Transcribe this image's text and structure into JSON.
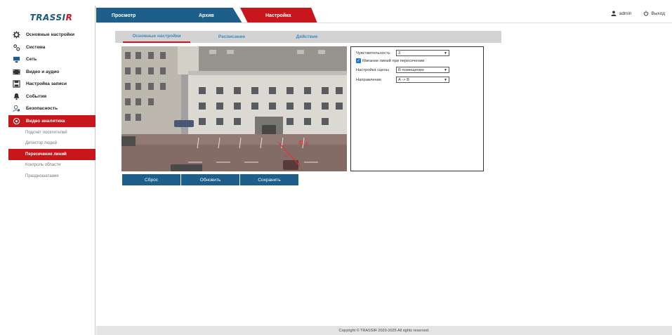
{
  "brand": {
    "logo_main": "TRASSI",
    "logo_r": "R"
  },
  "sidebar": {
    "items": [
      {
        "label": "Основные настройки",
        "icon": "gear-icon"
      },
      {
        "label": "Система",
        "icon": "gears-icon"
      },
      {
        "label": "Сеть",
        "icon": "network-icon"
      },
      {
        "label": "Видео и аудио",
        "icon": "video-icon"
      },
      {
        "label": "Настройка записи",
        "icon": "save-icon"
      },
      {
        "label": "События",
        "icon": "bell-icon"
      },
      {
        "label": "Безопасность",
        "icon": "user-lock-icon"
      },
      {
        "label": "Видео аналитика",
        "icon": "analytics-icon"
      }
    ],
    "subitems": [
      {
        "label": "Подсчёт посетителей"
      },
      {
        "label": "Детектор людей"
      },
      {
        "label": "Пересечение линий"
      },
      {
        "label": "Контроль области"
      },
      {
        "label": "Праздношатание"
      }
    ]
  },
  "topnav": {
    "tabs": [
      {
        "label": "Просмотр"
      },
      {
        "label": "Архив"
      },
      {
        "label": "Настройка"
      }
    ],
    "user": "admin",
    "logout": "Выход"
  },
  "subtabs": [
    {
      "label": "Основные настройки"
    },
    {
      "label": "Расписание"
    },
    {
      "label": "Действие"
    }
  ],
  "settings": {
    "sensitivity_label": "Чувствительность",
    "sensitivity_value": "3",
    "blink_label": "Мигание линий при пересечении",
    "blink_checked": true,
    "scene_label": "Настройка сцены",
    "scene_value": "В помещении",
    "direction_label": "Направление",
    "direction_value": "A -> B"
  },
  "buttons": {
    "reset": "Сброс",
    "refresh": "Обновить",
    "save": "Сохранить"
  },
  "line_markers": {
    "a": "A",
    "b": "B"
  },
  "footer": "Copyright © TRASSIR 2020-2025 All rights reserved.",
  "colors": {
    "accent_red": "#c8161d",
    "accent_blue": "#1d5f8a",
    "tab_text_blue": "#3a8bc2"
  }
}
